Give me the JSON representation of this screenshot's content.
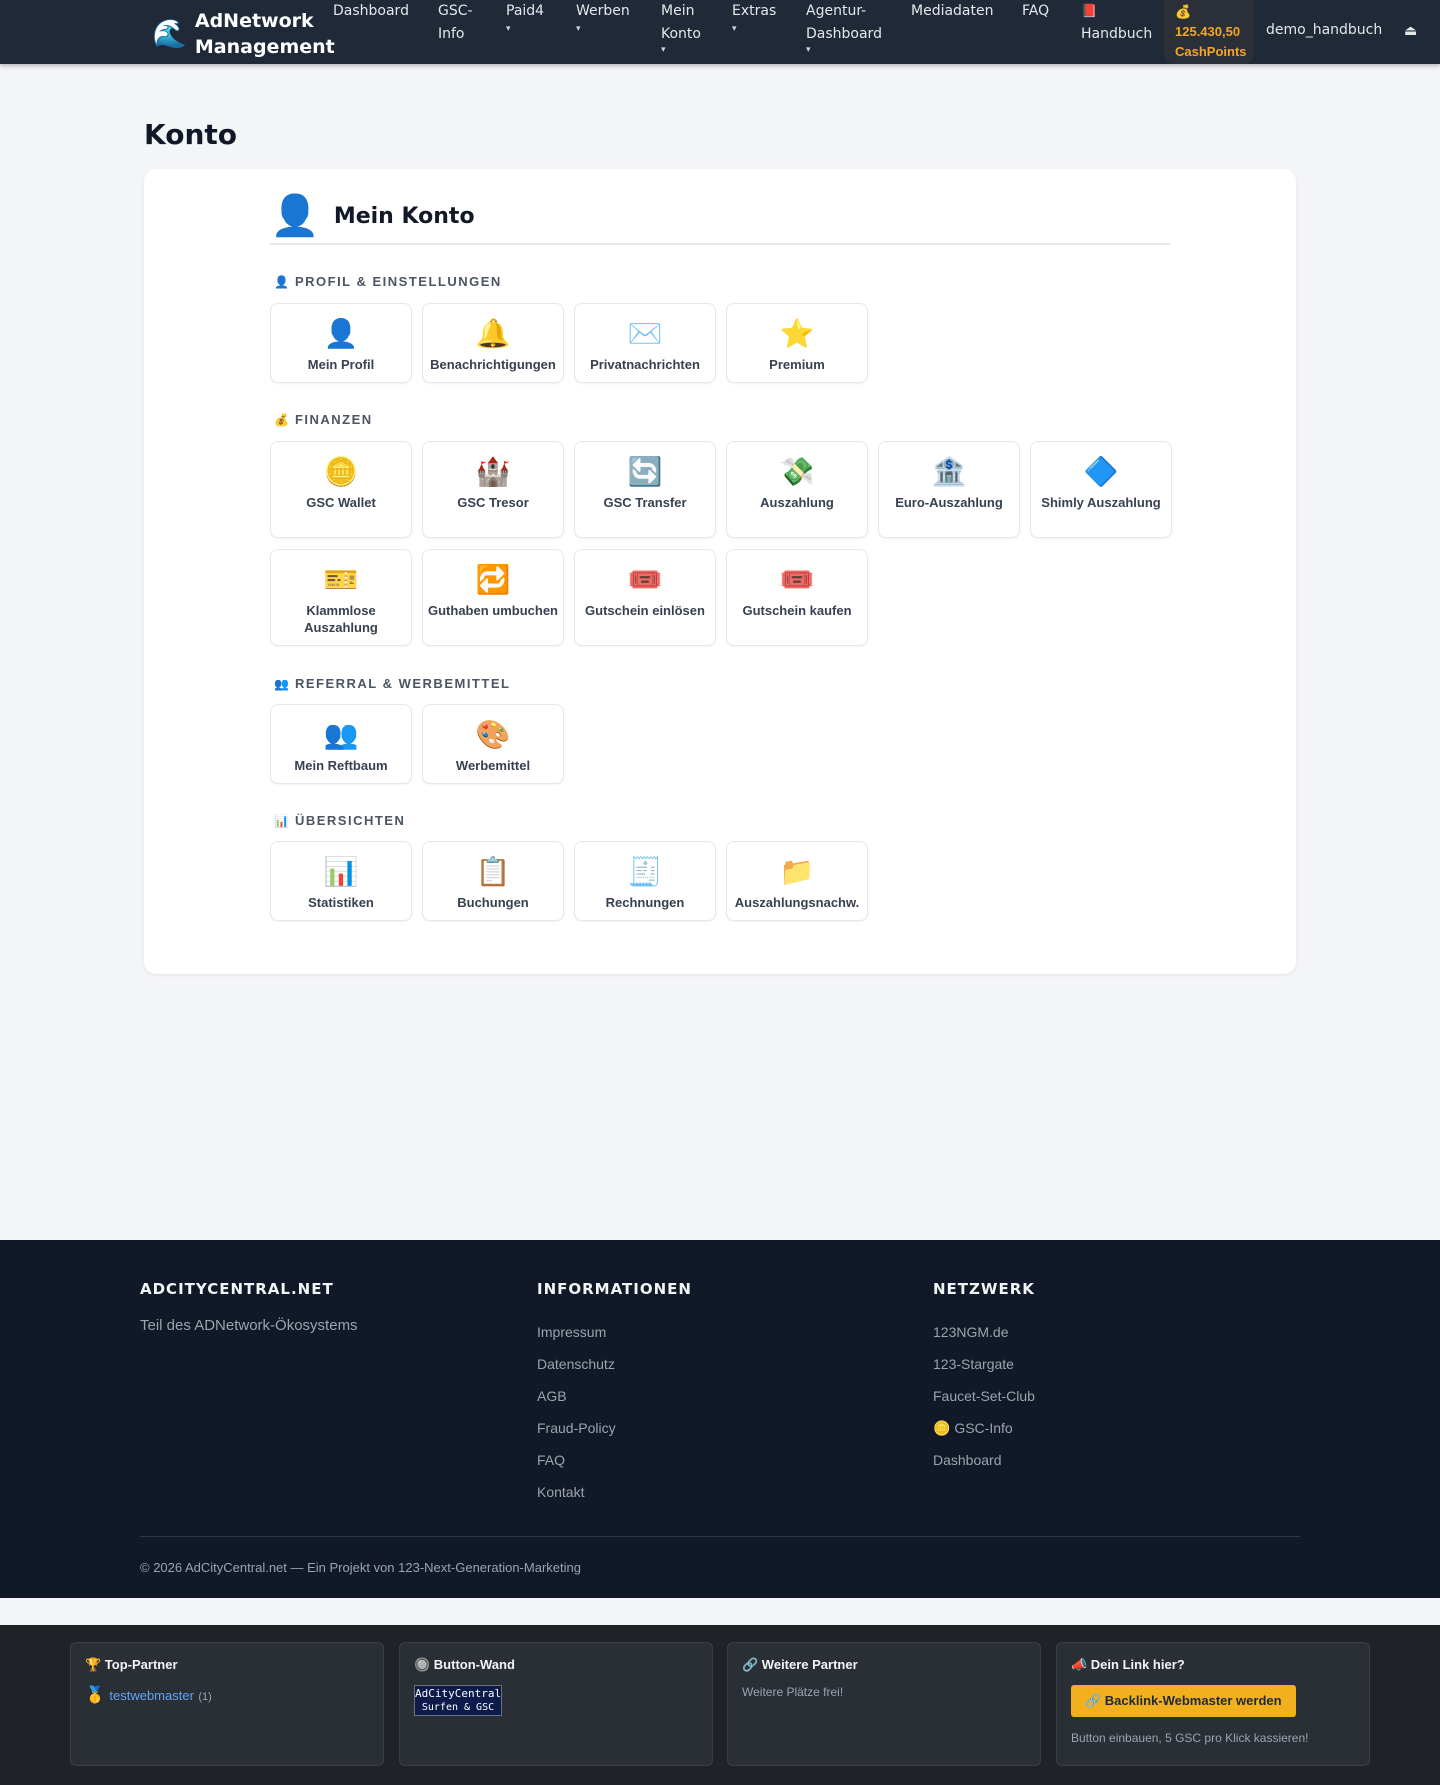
{
  "brand": {
    "icon": "🌊",
    "title": "AdNetwork Management"
  },
  "nav": {
    "items": [
      {
        "label": "Dashboard",
        "caret": ""
      },
      {
        "label": "GSC-Info",
        "caret": ""
      },
      {
        "label": "Paid4",
        "caret": "▾"
      },
      {
        "label": "Werben",
        "caret": "▾"
      },
      {
        "label": "Mein Konto",
        "caret": "▾"
      },
      {
        "label": "Extras",
        "caret": "▾"
      },
      {
        "label": "Agentur-Dashboard",
        "caret": "▾"
      },
      {
        "label": "Mediadaten",
        "caret": ""
      },
      {
        "label": "FAQ",
        "caret": ""
      }
    ],
    "handbuch_icon": "📕",
    "handbuch": "Handbuch",
    "cashpoints_icon": "💰",
    "cashpoints_value": "125.430,50",
    "cashpoints_label": "CashPoints",
    "username": "demo_handbuch",
    "logout_icon": "⏏"
  },
  "page": {
    "title": "Konto"
  },
  "card": {
    "icon": "👤",
    "title": "Mein Konto",
    "sections": [
      {
        "icon": "👤",
        "label": "Profil & Einstellungen",
        "tiles": [
          {
            "icon": "👤",
            "label": "Mein Profil"
          },
          {
            "icon": "🔔",
            "label": "Benachrichtigungen"
          },
          {
            "icon": "✉️",
            "label": "Privatnachrichten"
          },
          {
            "icon": "⭐",
            "label": "Premium"
          }
        ]
      },
      {
        "icon": "💰",
        "label": "Finanzen",
        "tiles": [
          {
            "icon": "🪙",
            "label": "GSC Wallet"
          },
          {
            "icon": "🏰",
            "label": "GSC Tresor"
          },
          {
            "icon": "🔄",
            "label": "GSC Transfer"
          },
          {
            "icon": "💸",
            "label": "Auszahlung"
          },
          {
            "icon": "🏦",
            "label": "Euro-Auszahlung"
          },
          {
            "icon": "🔷",
            "label": "Shimly Auszahlung"
          },
          {
            "icon": "🎫",
            "label": "Klammlose Auszahlung"
          },
          {
            "icon": "🔁",
            "label": "Guthaben umbuchen"
          },
          {
            "icon": "🎟️",
            "label": "Gutschein einlösen"
          },
          {
            "icon": "🎟️",
            "label": "Gutschein kaufen"
          }
        ]
      },
      {
        "icon": "👥",
        "label": "Referral & Werbemittel",
        "tiles": [
          {
            "icon": "👥",
            "label": "Mein Reftbaum"
          },
          {
            "icon": "🎨",
            "label": "Werbemittel"
          }
        ]
      },
      {
        "icon": "📊",
        "label": "Übersichten",
        "tiles": [
          {
            "icon": "📊",
            "label": "Statistiken"
          },
          {
            "icon": "📋",
            "label": "Buchungen"
          },
          {
            "icon": "🧾",
            "label": "Rechnungen"
          },
          {
            "icon": "📁",
            "label": "Auszahlungsnachw."
          }
        ]
      }
    ]
  },
  "footer": {
    "col1": {
      "title": "ADCITYCENTRAL.NET",
      "text": "Teil des ADNetwork-Ökosystems"
    },
    "col2": {
      "title": "Informationen",
      "links": [
        "Impressum",
        "Datenschutz",
        "AGB",
        "Fraud-Policy",
        "FAQ",
        "Kontakt"
      ]
    },
    "col3": {
      "title": "Netzwerk",
      "links": [
        "123NGM.de",
        "123-Stargate",
        "Faucet-Set-Club",
        "🪙 GSC-Info",
        "Dashboard"
      ]
    },
    "copyright": "© 2026 AdCityCentral.net — Ein Projekt von 123-Next-Generation-Marketing"
  },
  "partners": {
    "top": {
      "title": "🏆 Top-Partner",
      "medal": "🥇",
      "name": "testwebmaster",
      "count": "(1)"
    },
    "wall": {
      "title": "🔘 Button-Wand",
      "btn_line1": "AdCityCentral",
      "btn_line2": "Surfen & GSC"
    },
    "more": {
      "title": "🔗 Weitere Partner",
      "text": "Weitere Plätze frei!"
    },
    "yours": {
      "title": "📣 Dein Link hier?",
      "button": "🔗 Backlink-Webmaster werden",
      "text": "Button einbauen, 5 GSC pro Klick kassieren!"
    }
  }
}
